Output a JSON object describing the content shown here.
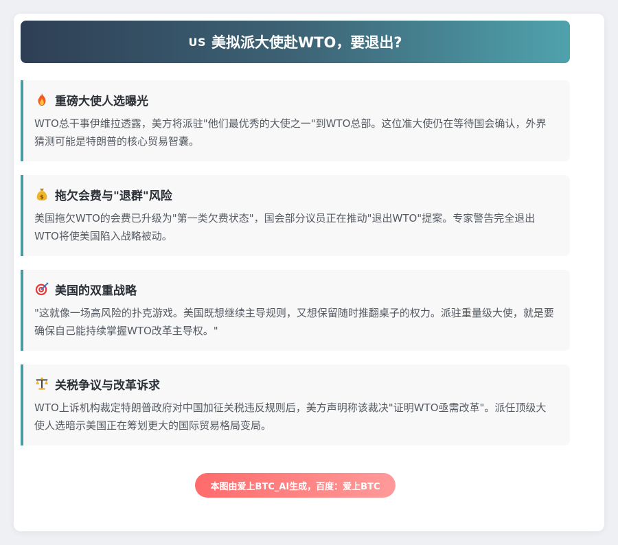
{
  "header": {
    "flag": "US",
    "title": "美拟派大使赴WTO，要退出?"
  },
  "sections": [
    {
      "icon": "fire-icon",
      "title": "重磅大使人选曝光",
      "text": "WTO总干事伊维拉透露，美方将派驻\"他们最优秀的大使之一\"到WTO总部。这位准大使仍在等待国会确认，外界猜测可能是特朗普的核心贸易智囊。"
    },
    {
      "icon": "money-bag-icon",
      "title": "拖欠会费与\"退群\"风险",
      "text": "美国拖欠WTO的会费已升级为\"第一类欠费状态\"，国会部分议员正在推动\"退出WTO\"提案。专家警告完全退出WTO将使美国陷入战略被动。"
    },
    {
      "icon": "target-icon",
      "title": "美国的双重战略",
      "text": "\"这就像一场高风险的扑克游戏。美国既想继续主导规则，又想保留随时推翻桌子的权力。派驻重量级大使，就是要确保自己能持续掌握WTO改革主导权。\""
    },
    {
      "icon": "scales-icon",
      "title": "关税争议与改革诉求",
      "text": "WTO上诉机构裁定特朗普政府对中国加征关税违反规则后，美方声明称该裁决\"证明WTO亟需改革\"。派任顶级大使人选暗示美国正在筹划更大的国际贸易格局变局。"
    }
  ],
  "footer": {
    "text": "本图由爱上BTC_AI生成，百度：爱上BTC"
  },
  "colors": {
    "accent": "#4a9aa5",
    "header_start": "#2e3f55",
    "header_end": "#4fa2ad",
    "footer_start": "#ff6b6b",
    "footer_end": "#ff9a9a"
  }
}
